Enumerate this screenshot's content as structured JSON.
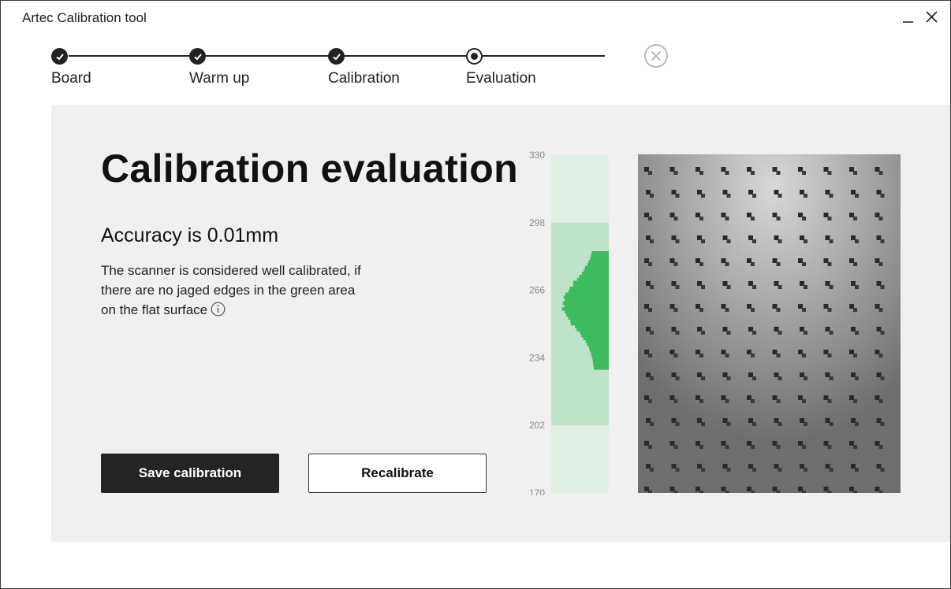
{
  "window": {
    "title": "Artec Calibration tool"
  },
  "stepper": {
    "steps": [
      {
        "label": "Board",
        "state": "done"
      },
      {
        "label": "Warm up",
        "state": "done"
      },
      {
        "label": "Calibration",
        "state": "done"
      },
      {
        "label": "Evaluation",
        "state": "current"
      }
    ]
  },
  "main": {
    "heading": "Calibration evaluation",
    "accuracy": "Accuracy is 0.01mm",
    "description": "The scanner is considered well calibrated, if there are no jaged edges in the green area on the flat surface",
    "save_label": "Save calibration",
    "recalibrate_label": "Recalibrate"
  },
  "histogram": {
    "ticks": [
      "330",
      "298",
      "266",
      "234",
      "202",
      "170"
    ],
    "range": [
      170,
      330
    ],
    "green_band": [
      202,
      298
    ],
    "colors": {
      "outer": "#e0efe4",
      "band": "#bfe3c8",
      "bars": "#3dbb5f",
      "text": "#8a8a8a"
    }
  },
  "colors": {
    "panel": "#f0f0f0",
    "primary_button": "#242424",
    "step": "#222222"
  }
}
